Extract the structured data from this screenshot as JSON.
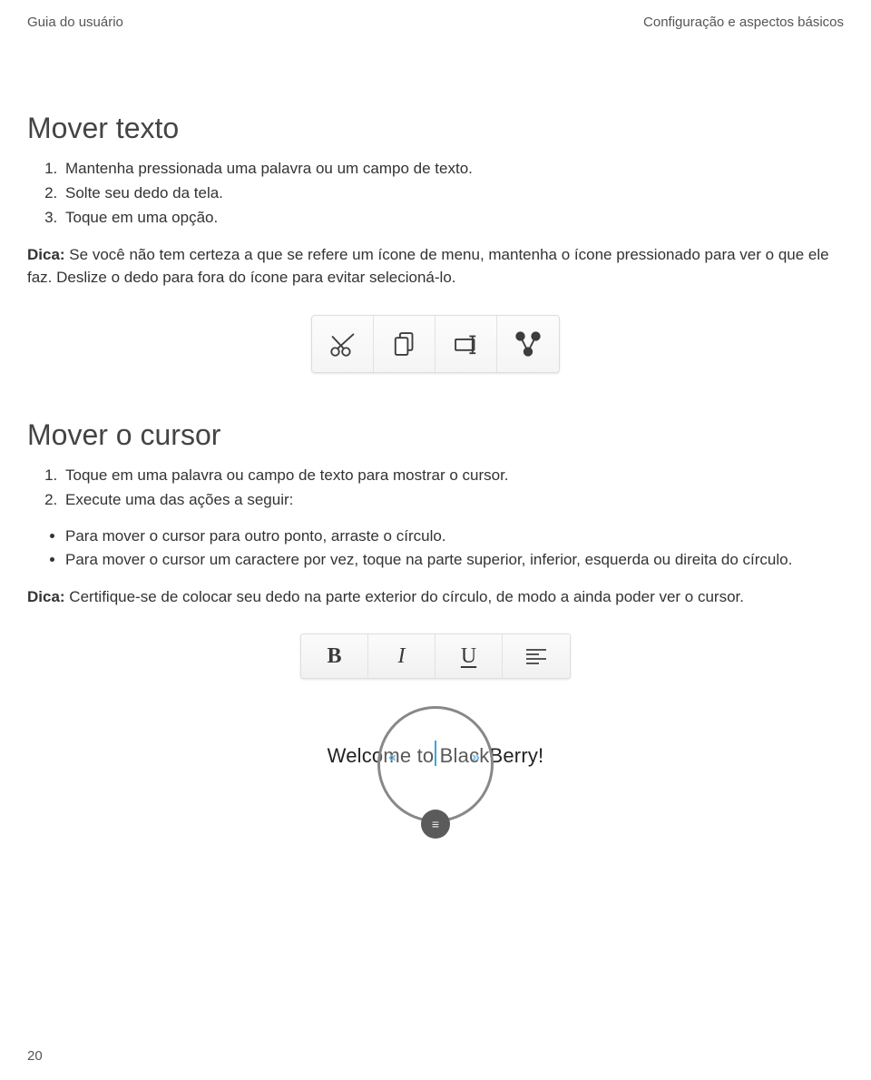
{
  "header": {
    "left": "Guia do usuário",
    "right": "Configuração e aspectos básicos"
  },
  "section1": {
    "title": "Mover texto",
    "steps": [
      "Mantenha pressionada uma palavra ou um campo de texto.",
      "Solte seu dedo da tela.",
      "Toque em uma opção."
    ],
    "tip_label": "Dica: ",
    "tip_body": "Se você não tem certeza a que se refere um ícone de menu, mantenha o ícone pressionado para ver o que ele faz. Deslize o dedo para fora do ícone para evitar selecioná-lo."
  },
  "iconbar": {
    "items": [
      "cut-icon",
      "copy-icon",
      "paste-icon",
      "share-icon"
    ]
  },
  "section2": {
    "title": "Mover o cursor",
    "steps": [
      "Toque em uma palavra ou campo de texto para mostrar o cursor.",
      "Execute uma das ações a seguir:"
    ],
    "bullets": [
      "Para mover o cursor para outro ponto, arraste o círculo.",
      "Para mover o cursor um caractere por vez, toque na parte superior, inferior, esquerda ou direita do círculo."
    ],
    "tip_label": "Dica: ",
    "tip_body": "Certifique-se de colocar seu dedo na parte exterior do círculo, de modo a ainda poder ver o cursor."
  },
  "fmtbar": {
    "bold": "B",
    "italic": "I",
    "underline": "U"
  },
  "cursor_demo": {
    "text": "Welcome to BlackBerry!"
  },
  "page_number": "20"
}
